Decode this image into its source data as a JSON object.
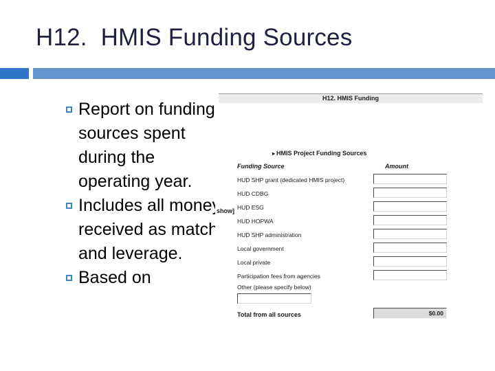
{
  "slide": {
    "title": "H12.  HMIS Funding Sources",
    "accent_dark": "#2e75c8",
    "accent_light": "#6596ce",
    "title_color": "#1f2040",
    "bullet_color": "#3d85c6"
  },
  "bullets": [
    {
      "text": "Report on funding sources spent during the operating year."
    },
    {
      "text": "Includes all money received as match and leverage."
    },
    {
      "text": "Based on"
    }
  ],
  "screenshot": {
    "window_title": "H12. HMIS Funding",
    "show_link": "show]",
    "section_title": "HMIS Project Funding Sources",
    "section_arrow": "▸",
    "columns": {
      "source": "Funding Source",
      "amount": "Amount"
    },
    "rows": [
      {
        "label": "HUD SHP grant (dedicated HMIS project)",
        "amount": ""
      },
      {
        "label": "HUD CDBG",
        "amount": ""
      },
      {
        "label": "HUD ESG",
        "amount": ""
      },
      {
        "label": "HUD HOPWA",
        "amount": ""
      },
      {
        "label": "HUD SHP administration",
        "amount": ""
      },
      {
        "label": "Local government",
        "amount": ""
      },
      {
        "label": "Local private",
        "amount": ""
      },
      {
        "label": "Participation fees from agencies",
        "amount": ""
      }
    ],
    "other_row": {
      "label": "Other (please specify below)",
      "specify_value": "",
      "amount": ""
    },
    "total_row": {
      "label": "Total from all sources",
      "value": "$0.00"
    }
  }
}
